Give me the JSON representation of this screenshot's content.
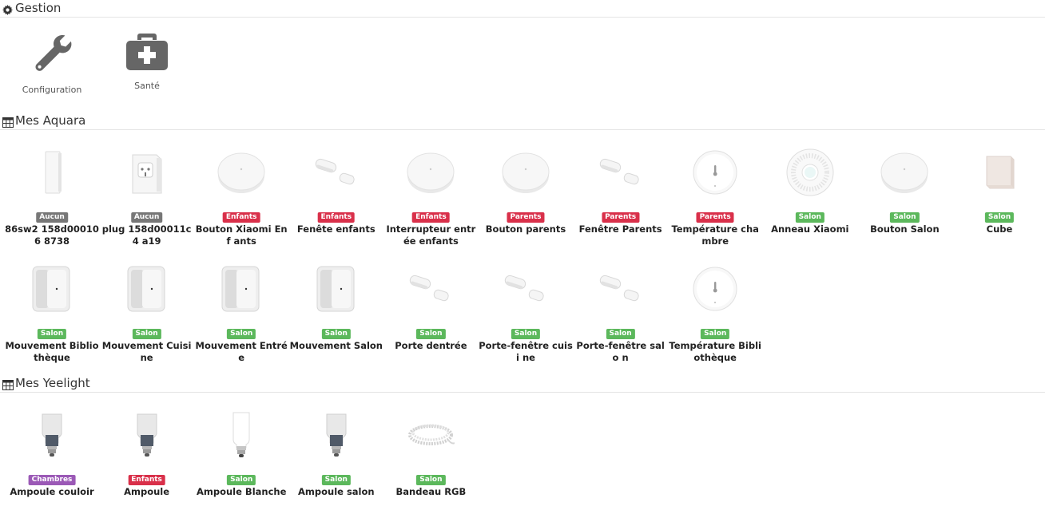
{
  "sections": {
    "gestion": {
      "title": "Gestion"
    },
    "aquara": {
      "title": "Mes Aquara"
    },
    "yeelight": {
      "title": "Mes Yeelight"
    }
  },
  "management": {
    "configuration_label": "Configuration",
    "sante_label": "Santé"
  },
  "colors": {
    "Aucun": "#777777",
    "Enfants": "#d9304a",
    "Parents": "#d9304a",
    "Salon": "#5cb85c",
    "Chambres": "#9b59b6",
    "icon_gray": "#666666"
  },
  "aquara_devices": [
    {
      "name": "86sw2 158d000106 8738",
      "room": "Aucun",
      "icon": "wall-switch-icon"
    },
    {
      "name": "plug 158d00011c4 a19",
      "room": "Aucun",
      "icon": "smart-plug-icon"
    },
    {
      "name": "Bouton Xiaomi Enf ants",
      "room": "Enfants",
      "icon": "round-button-icon"
    },
    {
      "name": "Fenête enfants",
      "room": "Enfants",
      "icon": "door-sensor-icon"
    },
    {
      "name": "Interrupteur entr ée enfants",
      "room": "Enfants",
      "icon": "round-button-icon"
    },
    {
      "name": "Bouton parents",
      "room": "Parents",
      "icon": "round-button-icon"
    },
    {
      "name": "Fenêtre Parents",
      "room": "Parents",
      "icon": "door-sensor-icon"
    },
    {
      "name": "Température cha mbre",
      "room": "Parents",
      "icon": "temperature-sensor-icon"
    },
    {
      "name": "Anneau Xiaomi",
      "room": "Salon",
      "icon": "gateway-ring-icon"
    },
    {
      "name": "Bouton Salon",
      "room": "Salon",
      "icon": "round-button-icon"
    },
    {
      "name": "Cube",
      "room": "Salon",
      "icon": "cube-icon"
    },
    {
      "name": "Mouvement Biblio thèque",
      "room": "Salon",
      "icon": "motion-sensor-icon"
    },
    {
      "name": "Mouvement Cuisi ne",
      "room": "Salon",
      "icon": "motion-sensor-icon"
    },
    {
      "name": "Mouvement Entré e",
      "room": "Salon",
      "icon": "motion-sensor-icon"
    },
    {
      "name": "Mouvement Salon",
      "room": "Salon",
      "icon": "motion-sensor-icon"
    },
    {
      "name": "Porte dentrée",
      "room": "Salon",
      "icon": "door-sensor-icon"
    },
    {
      "name": "Porte-fenêtre cuisi ne",
      "room": "Salon",
      "icon": "door-sensor-icon"
    },
    {
      "name": "Porte-fenêtre salo n",
      "room": "Salon",
      "icon": "door-sensor-icon"
    },
    {
      "name": "Température Bibli othèque",
      "room": "Salon",
      "icon": "temperature-sensor-icon"
    }
  ],
  "yeelight_devices": [
    {
      "name": "Ampoule couloir",
      "room": "Chambres",
      "icon": "color-bulb-icon"
    },
    {
      "name": "Ampoule",
      "room": "Enfants",
      "icon": "color-bulb-icon"
    },
    {
      "name": "Ampoule Blanche",
      "room": "Salon",
      "icon": "white-bulb-icon"
    },
    {
      "name": "Ampoule salon",
      "room": "Salon",
      "icon": "color-bulb-icon"
    },
    {
      "name": "Bandeau RGB",
      "room": "Salon",
      "icon": "led-strip-icon"
    }
  ]
}
